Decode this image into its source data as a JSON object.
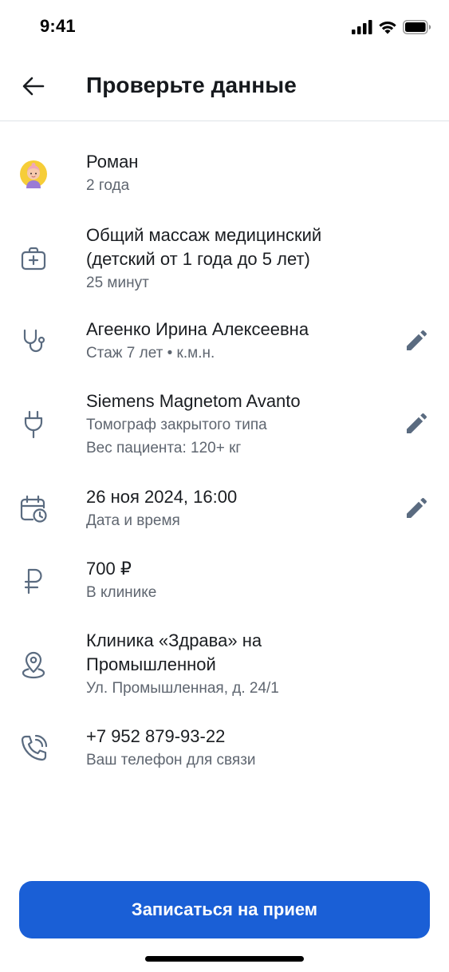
{
  "status_bar": {
    "time": "9:41"
  },
  "header": {
    "title": "Проверьте данные",
    "back_icon": "arrow-left-icon"
  },
  "patient": {
    "name": "Роман",
    "age": "2 года"
  },
  "service": {
    "name_line1": "Общий массаж медицинский",
    "name_line2": "(детский от 1 года до 5 лет)",
    "duration": "25 минут",
    "icon": "medical-kit-icon"
  },
  "doctor": {
    "name": "Агеенко Ирина Алексеевна",
    "details": "Стаж 7 лет • к.м.н.",
    "icon": "stethoscope-icon"
  },
  "equipment": {
    "name": "Siemens Magnetom Avanto",
    "type": "Томограф закрытого типа",
    "weight": "Вес пациента: 120+ кг",
    "icon": "plug-icon"
  },
  "datetime": {
    "value": "26 ноя 2024, 16:00",
    "label": "Дата и время",
    "icon": "calendar-clock-icon"
  },
  "price": {
    "value": "700 ₽",
    "label": "В клинике",
    "icon": "ruble-icon"
  },
  "clinic": {
    "name_line1": "Клиника «Здрава» на",
    "name_line2": "Промышленной",
    "address": "Ул. Промышленная, д. 24/1",
    "icon": "location-pin-icon"
  },
  "phone": {
    "value": "+7 952 879-93-22",
    "label": "Ваш телефон для связи",
    "icon": "phone-icon"
  },
  "cta": {
    "label": "Записаться на прием"
  },
  "colors": {
    "accent": "#1a5fd6",
    "icon": "#5a6b80",
    "secondary_text": "#5f6670",
    "divider": "#dfe3e8"
  }
}
